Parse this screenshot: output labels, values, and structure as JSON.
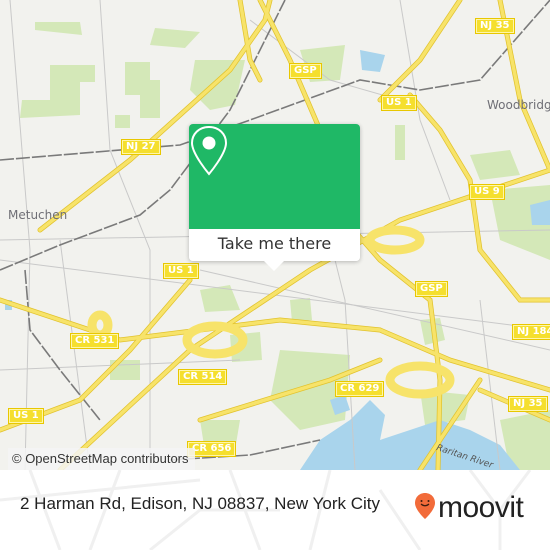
{
  "map": {
    "place_labels": [
      {
        "id": "metuchen",
        "text": "Metuchen"
      },
      {
        "id": "woodbridge",
        "text": "Woodbridge"
      }
    ],
    "road_shields": [
      {
        "id": "nj27",
        "text": "NJ 27"
      },
      {
        "id": "gsp-north",
        "text": "GSP"
      },
      {
        "id": "us1-north",
        "text": "US 1"
      },
      {
        "id": "nj35-north",
        "text": "NJ 35"
      },
      {
        "id": "us9",
        "text": "US 9"
      },
      {
        "id": "us1-center",
        "text": "US 1"
      },
      {
        "id": "gsp-center",
        "text": "GSP"
      },
      {
        "id": "cr531",
        "text": "CR 531"
      },
      {
        "id": "nj184",
        "text": "NJ 184"
      },
      {
        "id": "cr514",
        "text": "CR 514"
      },
      {
        "id": "cr629",
        "text": "CR 629"
      },
      {
        "id": "nj35-south",
        "text": "NJ 35"
      },
      {
        "id": "us1-west",
        "text": "US 1"
      },
      {
        "id": "cr656",
        "text": "CR 656"
      }
    ],
    "water_labels": [
      {
        "id": "raritan",
        "text": "Raritan River"
      }
    ],
    "attribution": "© OpenStreetMap contributors",
    "colors": {
      "land": "#f2f2ee",
      "park": "#d4e8b8",
      "water": "#a9d4ec",
      "highway": "#f7e36a",
      "rail": "#777777"
    }
  },
  "popup": {
    "icon": "location-pin-icon",
    "button_label": "Take me there",
    "color": "#1fb866"
  },
  "footer": {
    "address": "2 Harman Rd, Edison, NJ 08837, New York City",
    "brand": "moovit",
    "brand_color": "#f26b3a"
  }
}
